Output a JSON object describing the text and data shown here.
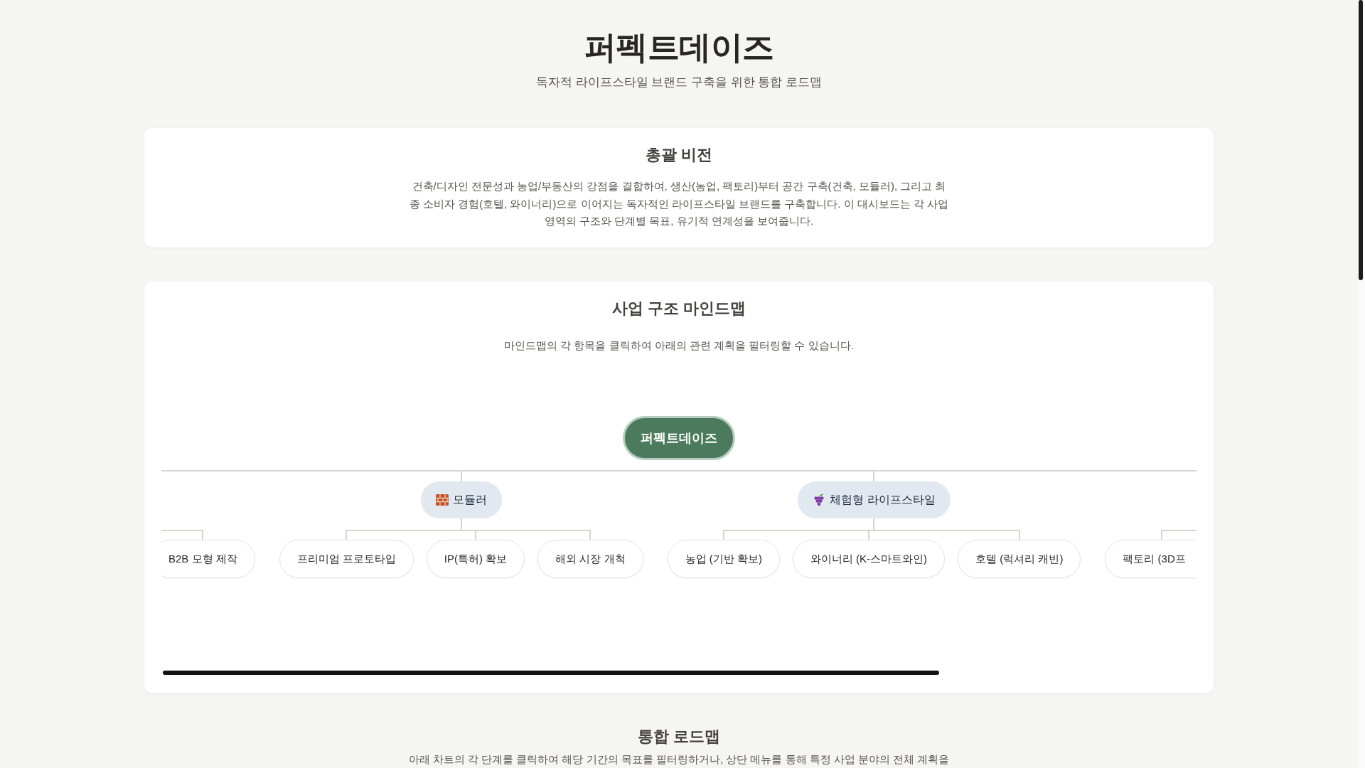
{
  "header": {
    "title": "퍼펙트데이즈",
    "subtitle": "독자적 라이프스타일 브랜드 구축을 위한 통합 로드맵"
  },
  "vision": {
    "title": "총괄 비전",
    "body": "건축/디자인 전문성과 농업/부동산의 강점을 결합하여, 생산(농업, 팩토리)부터 공간 구축(건축, 모듈러), 그리고 최종 소비자 경험(호텔, 와이너리)으로 이어지는 독자적인 라이프스타일 브랜드를 구축합니다. 이 대시보드는 각 사업 영역의 구조와 단계별 목표, 유기적 연계성을 보여줍니다."
  },
  "mindmap": {
    "title": "사업 구조 마인드맵",
    "description": "마인드맵의 각 항목을 클릭하여 아래의 관련 계획을 필터링할 수 있습니다.",
    "root": "퍼펙트데이즈",
    "branches": [
      {
        "children": [
          "B2B 모형 제작"
        ]
      },
      {
        "label": "모듈러",
        "children": [
          "프리미엄 프로토타입",
          "IP(특허) 확보",
          "해외 시장 개척"
        ]
      },
      {
        "label": "체험형 라이프스타일",
        "children": [
          "농업 (기반 확보)",
          "와이너리 (K-스마트와인)",
          "호텔 (럭셔리 캐빈)"
        ]
      },
      {
        "children": [
          "팩토리 (3D프"
        ]
      }
    ]
  },
  "roadmap": {
    "title": "통합 로드맵",
    "description": "아래 차트의 각 단계를 클릭하여 해당 기간의 목표를 필터링하거나, 상단 메뉴를 통해 특정 사업 분야의 전체 계획을"
  }
}
